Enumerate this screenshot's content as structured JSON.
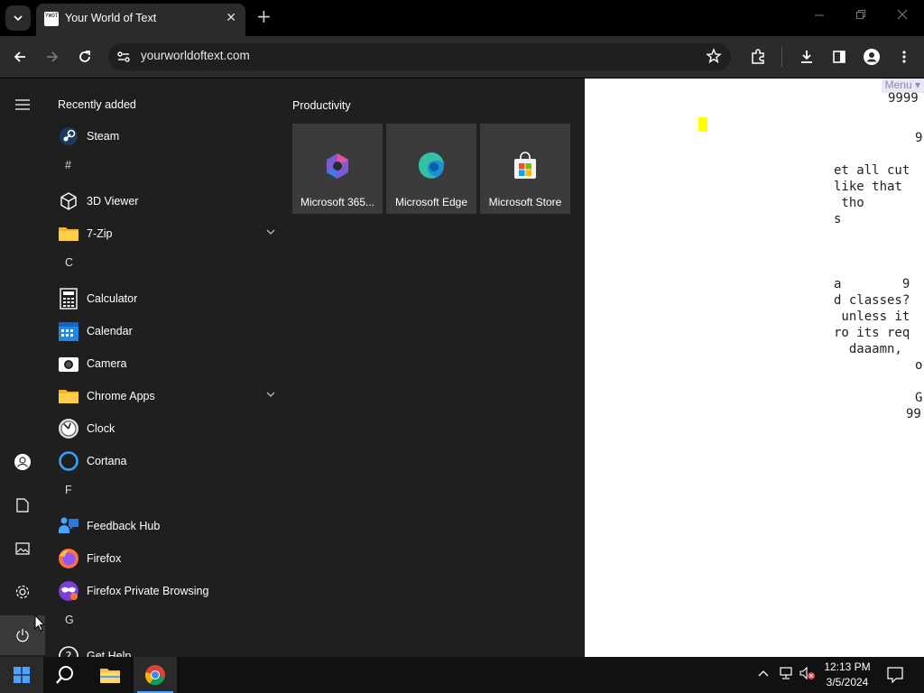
{
  "browser": {
    "tab_title": "Your World of Text",
    "favicon_text": "YWOT",
    "url": "yourworldoftext.com",
    "new_tab": "+",
    "close_tab": "✕"
  },
  "webpage": {
    "menu_label": "Menu ▾",
    "lines": [
      {
        "text": "9999",
        "row": 0
      },
      {
        "text": "9",
        "row": 1
      },
      {
        "text": "et all cut",
        "row": 2
      },
      {
        "text": "like that",
        "row": 3
      },
      {
        "text": " tho",
        "row": 4
      },
      {
        "text": "s",
        "row": 5
      },
      {
        "text": "a        9",
        "row": 6
      },
      {
        "text": "d classes?",
        "row": 7
      },
      {
        "text": " unless it",
        "row": 8
      },
      {
        "text": "ro its req",
        "row": 9
      },
      {
        "text": "  daaamn,",
        "row": 10
      },
      {
        "text": "o",
        "row": 11
      },
      {
        "text": "G",
        "row": 12
      },
      {
        "text": "99",
        "row": 13
      }
    ]
  },
  "start_menu": {
    "recently_added": "Recently added",
    "productivity": "Productivity",
    "apps": [
      {
        "type": "app",
        "label": "Steam",
        "icon": "steam-icon"
      },
      {
        "type": "letter",
        "label": "#"
      },
      {
        "type": "app",
        "label": "3D Viewer",
        "icon": "cube-icon"
      },
      {
        "type": "folder",
        "label": "7-Zip",
        "icon": "folder-icon"
      },
      {
        "type": "letter",
        "label": "C"
      },
      {
        "type": "app",
        "label": "Calculator",
        "icon": "calculator-icon"
      },
      {
        "type": "app",
        "label": "Calendar",
        "icon": "calendar-icon"
      },
      {
        "type": "app",
        "label": "Camera",
        "icon": "camera-icon"
      },
      {
        "type": "folder",
        "label": "Chrome Apps",
        "icon": "folder-icon"
      },
      {
        "type": "app",
        "label": "Clock",
        "icon": "clock-icon"
      },
      {
        "type": "app",
        "label": "Cortana",
        "icon": "cortana-icon"
      },
      {
        "type": "letter",
        "label": "F"
      },
      {
        "type": "app",
        "label": "Feedback Hub",
        "icon": "feedback-hub-icon"
      },
      {
        "type": "app",
        "label": "Firefox",
        "icon": "firefox-icon"
      },
      {
        "type": "app",
        "label": "Firefox Private Browsing",
        "icon": "firefox-private-icon"
      },
      {
        "type": "letter",
        "label": "G"
      },
      {
        "type": "app",
        "label": "Get Help",
        "icon": "help-icon"
      }
    ],
    "tiles": [
      {
        "label": "Microsoft 365...",
        "icon": "microsoft-365-icon"
      },
      {
        "label": "Microsoft Edge",
        "icon": "edge-icon"
      },
      {
        "label": "Microsoft Store",
        "icon": "store-icon"
      }
    ]
  },
  "taskbar": {
    "time": "12:13 PM",
    "date": "3/5/2024"
  },
  "colors": {
    "start_bg": "#1f1f1f",
    "tile_bg": "#3b3b3b",
    "cursor_yellow": "#ffff00",
    "accent_blue": "#4aa3ff"
  }
}
